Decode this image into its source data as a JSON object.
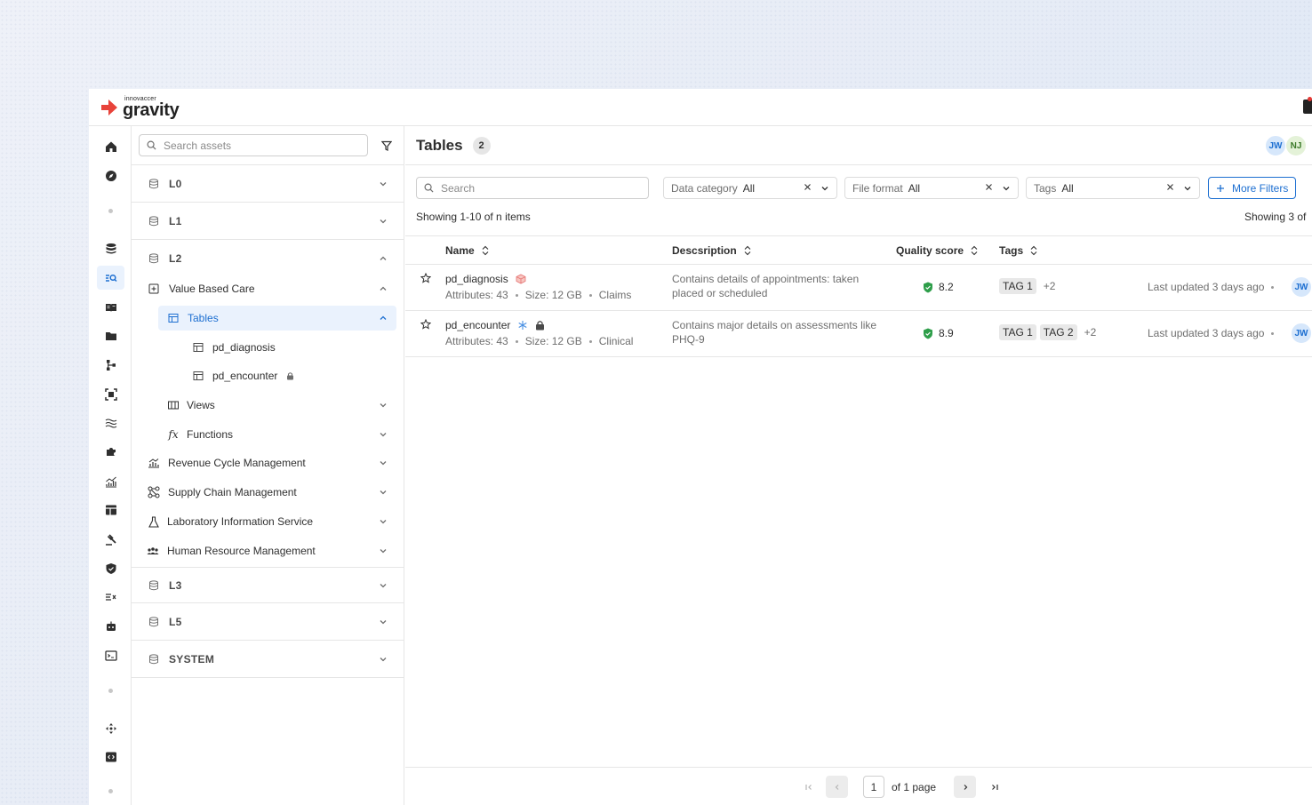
{
  "brand": {
    "small": "innovaccer",
    "name": "gravity",
    "accent": "#e8433a"
  },
  "colors": {
    "primary": "#1d6fd1",
    "border": "#e6e6e6"
  },
  "sidebar_icons": [
    "home-icon",
    "compass-icon",
    "database-icon",
    "search-list-icon",
    "book-icon",
    "folder-icon",
    "hierarchy-icon",
    "scan-icon",
    "waves-icon",
    "puzzle-icon",
    "chart-icon",
    "layout-icon",
    "gavel-icon",
    "shield-icon",
    "list-check-icon",
    "robot-icon",
    "terminal-icon",
    "move-icon",
    "code-icon"
  ],
  "tree": {
    "search_placeholder": "Search assets",
    "levels": {
      "l0": "L0",
      "l1": "L1",
      "l2": "L2",
      "l3": "L3",
      "l5": "L5",
      "system": "SYSTEM"
    },
    "value_based_care": "Value Based Care",
    "tables": "Tables",
    "pd_diagnosis": "pd_diagnosis",
    "pd_encounter": "pd_encounter",
    "views": "Views",
    "functions": "Functions",
    "revenue": "Revenue Cycle Management",
    "supply": "Supply Chain Management",
    "lab": "Laboratory Information Service",
    "hr": "Human Resource Management"
  },
  "main": {
    "title": "Tables",
    "count": "2",
    "avatars": [
      "JW",
      "NJ"
    ],
    "search_placeholder": "Search",
    "filters": {
      "data_category": {
        "label": "Data category",
        "value": "All"
      },
      "file_format": {
        "label": "File format",
        "value": "All"
      },
      "tags": {
        "label": "Tags",
        "value": "All"
      },
      "more": "More Filters"
    },
    "showing_left": "Showing 1-10 of n items",
    "showing_right": "Showing 3 of",
    "columns": {
      "name": "Name",
      "description": "Descsription",
      "quality": "Quality score",
      "tags": "Tags"
    },
    "rows": [
      {
        "name": "pd_diagnosis",
        "attributes": "Attributes: 43",
        "size": "Size: 12 GB",
        "category": "Claims",
        "description": "Contains details of appointments: taken placed or scheduled",
        "score": "8.2",
        "tag1": "TAG 1",
        "more_tags": "+2",
        "updated": "Last updated 3 days ago",
        "owner": "JW"
      },
      {
        "name": "pd_encounter",
        "attributes": "Attributes: 43",
        "size": "Size: 12 GB",
        "category": "Clinical",
        "description": "Contains major details on assessments like PHQ-9",
        "score": "8.9",
        "tag1": "TAG 1",
        "tag2": "TAG 2",
        "more_tags": "+2",
        "updated": "Last updated 3 days ago",
        "owner": "JW"
      }
    ],
    "pagination": {
      "page": "1",
      "of_pages": "of 1 page"
    }
  }
}
